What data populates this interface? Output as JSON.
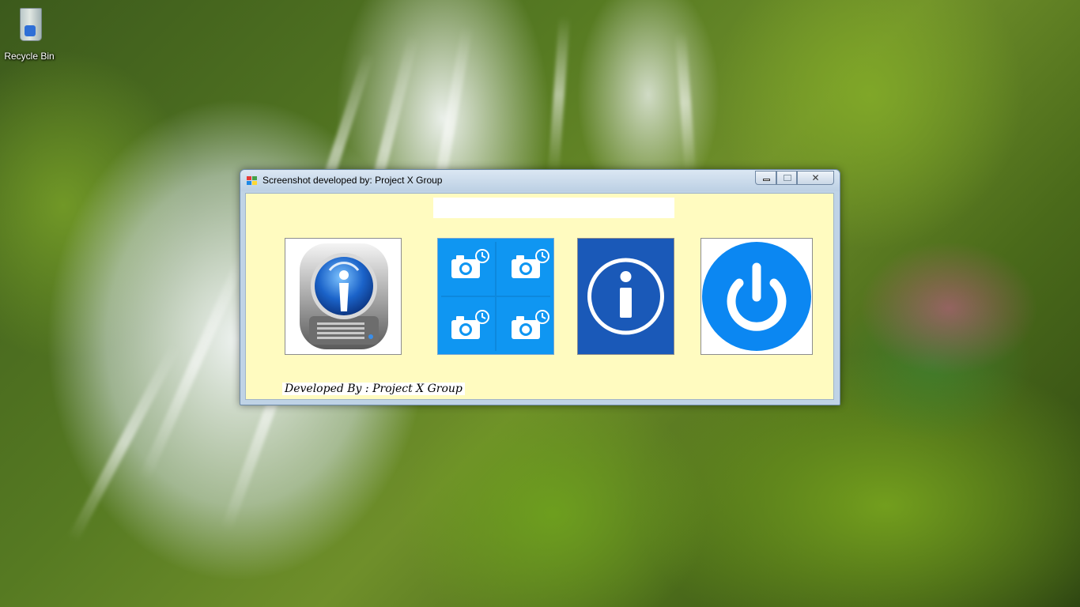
{
  "desktop": {
    "icons": [
      {
        "label": "Recycle Bin",
        "icon": "recycle-bin-icon"
      }
    ]
  },
  "window": {
    "title": "Screenshot developed by: Project X Group",
    "app_icon": "application-icon",
    "caption_buttons": {
      "minimize": "minimize-icon",
      "maximize": "maximize-icon",
      "close": "close-icon",
      "close_glyph": "✕"
    }
  },
  "main": {
    "top_field": {
      "value": "",
      "placeholder": ""
    },
    "tiles": [
      {
        "name": "info-drive",
        "icon": "info-drive-icon"
      },
      {
        "name": "screenshot",
        "icon": "camera-timer-icon"
      },
      {
        "name": "about",
        "icon": "info-icon"
      },
      {
        "name": "exit",
        "icon": "power-icon"
      }
    ],
    "credit": "Developed By : Project X Group"
  },
  "colors": {
    "client_background": "#fffbc0",
    "screenshot_tile": "#0f96f2",
    "about_tile": "#1a59b8",
    "power_blue": "#0b87f2"
  }
}
